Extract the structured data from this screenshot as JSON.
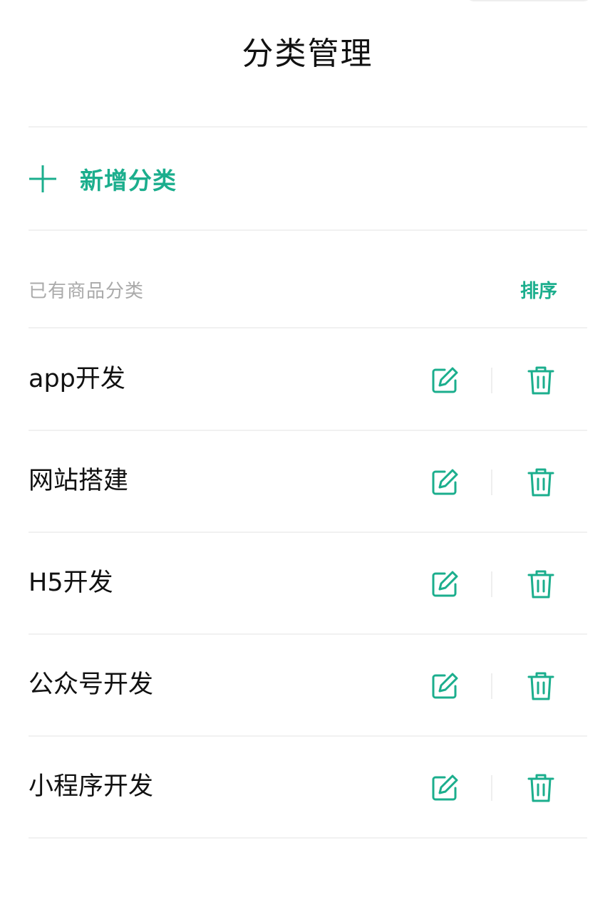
{
  "colors": {
    "accent": "#1bae8d",
    "muted_text": "#aaaaaa",
    "divider": "#f1f1f1"
  },
  "header": {
    "title": "分类管理"
  },
  "add_action": {
    "icon": "plus-icon",
    "label": "新增分类"
  },
  "section": {
    "title": "已有商品分类",
    "sort_label": "排序"
  },
  "categories": [
    {
      "name": "app开发",
      "edit_icon": "edit-icon",
      "delete_icon": "trash-icon"
    },
    {
      "name": "网站搭建",
      "edit_icon": "edit-icon",
      "delete_icon": "trash-icon"
    },
    {
      "name": "H5开发",
      "edit_icon": "edit-icon",
      "delete_icon": "trash-icon"
    },
    {
      "name": "公众号开发",
      "edit_icon": "edit-icon",
      "delete_icon": "trash-icon"
    },
    {
      "name": "小程序开发",
      "edit_icon": "edit-icon",
      "delete_icon": "trash-icon"
    }
  ]
}
